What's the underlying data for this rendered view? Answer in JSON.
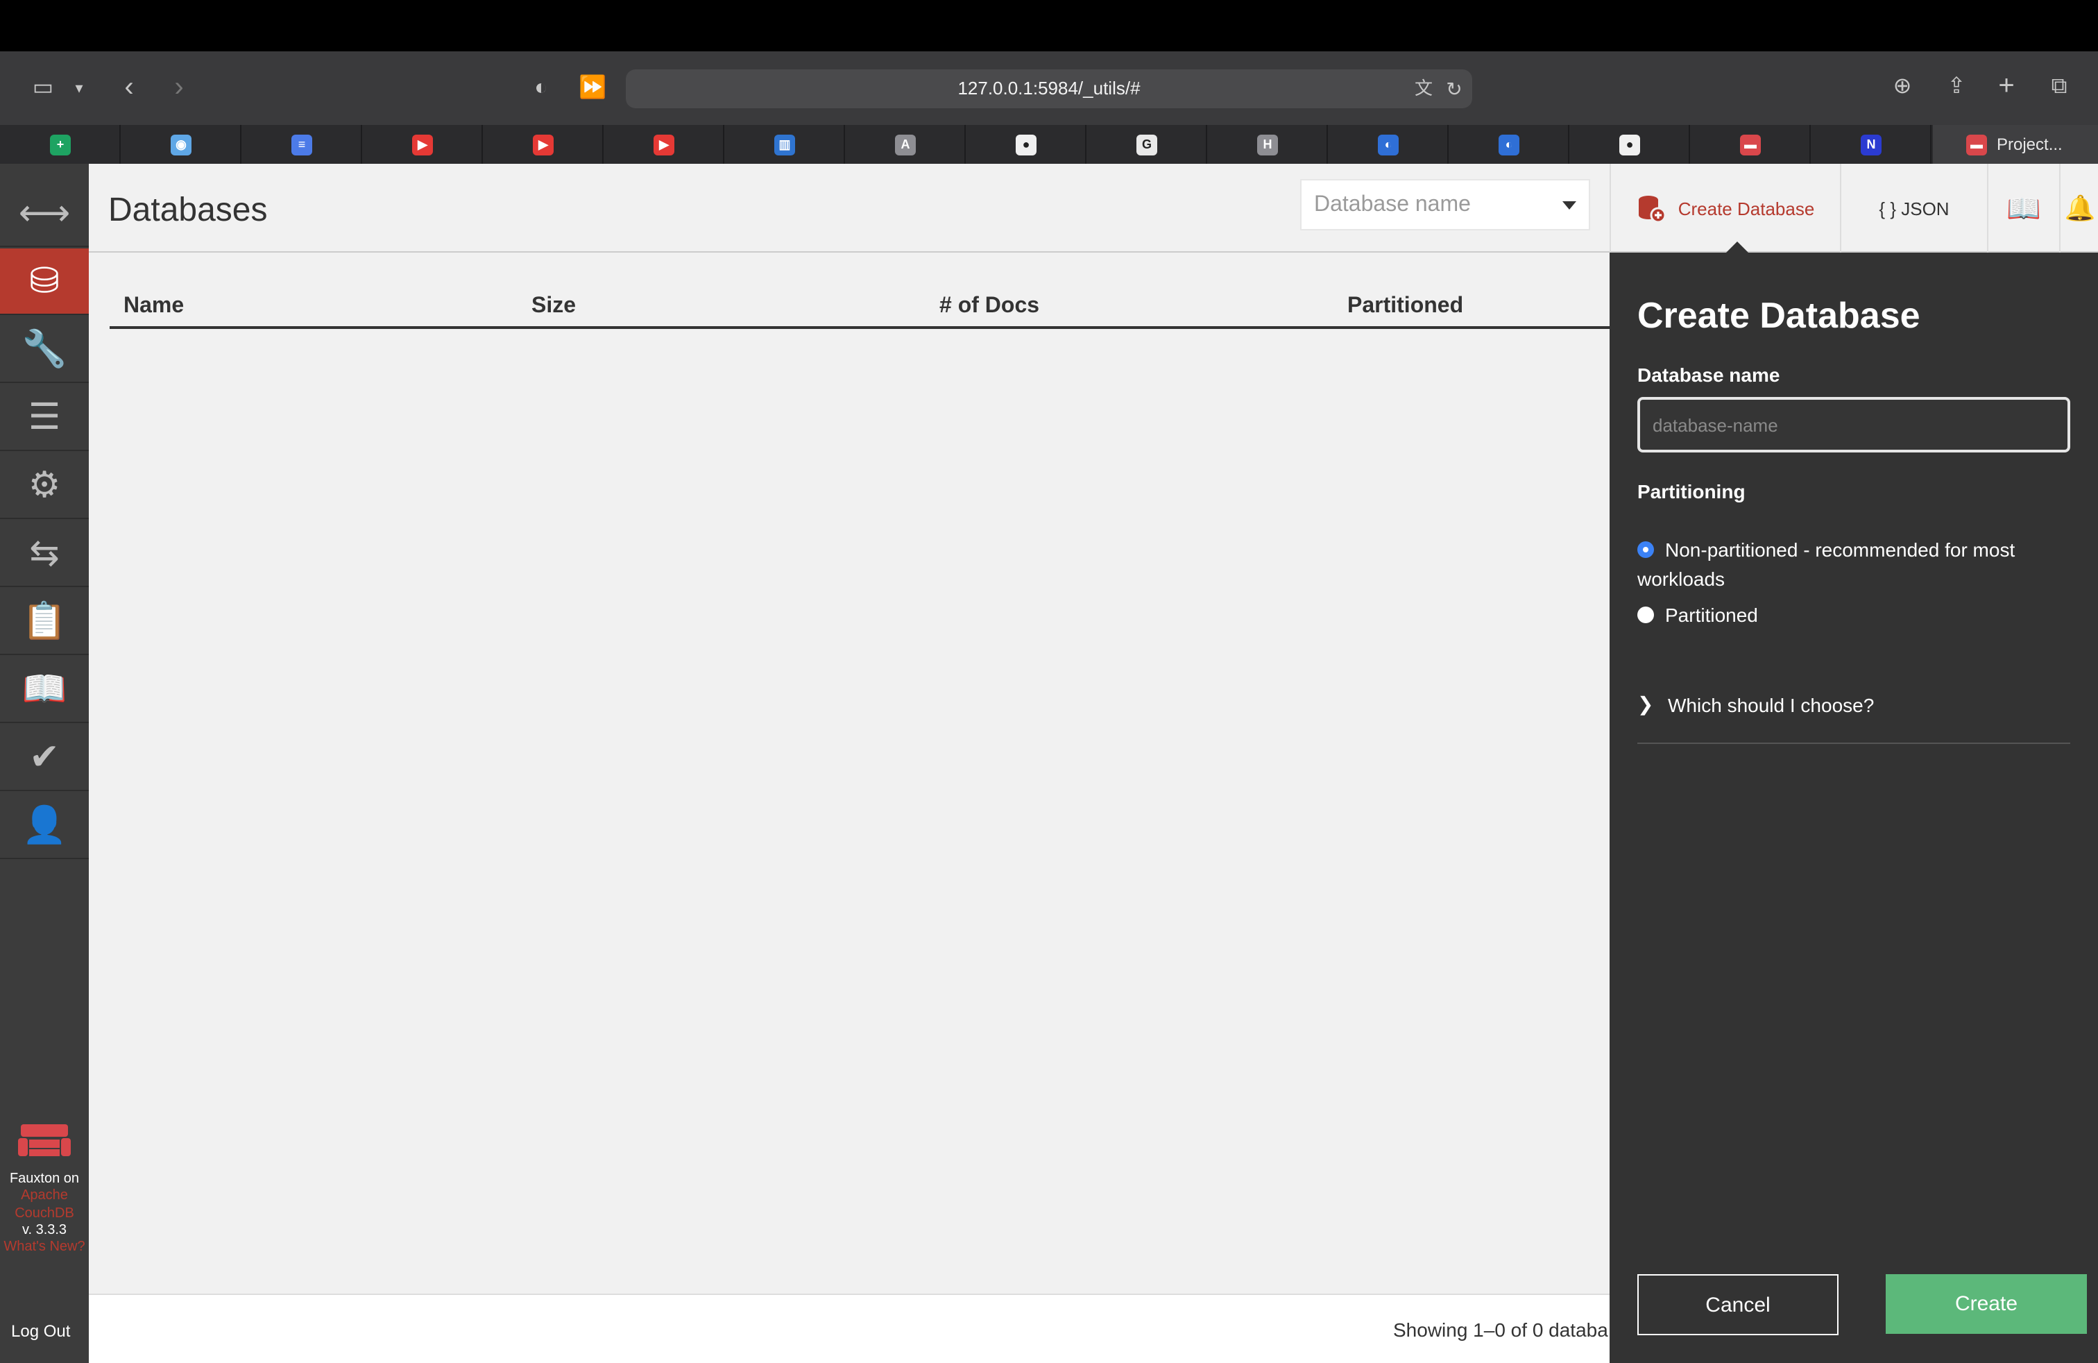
{
  "browser": {
    "url": "127.0.0.1:5984/_utils/#",
    "active_tab_label": "Project...",
    "bookmarks": [
      {
        "icon": "sheets-icon",
        "color": "#1ea362",
        "glyph": "+"
      },
      {
        "icon": "reddit-icon",
        "color": "#5fa7e6",
        "glyph": "◉"
      },
      {
        "icon": "docs-icon",
        "color": "#4c7be8",
        "glyph": "≡"
      },
      {
        "icon": "youtube-icon",
        "color": "#e53935",
        "glyph": "▶"
      },
      {
        "icon": "youtube-icon",
        "color": "#e53935",
        "glyph": "▶"
      },
      {
        "icon": "youtube-icon",
        "color": "#e53935",
        "glyph": "▶"
      },
      {
        "icon": "trello-icon",
        "color": "#2f74d0",
        "glyph": "▥"
      },
      {
        "icon": "a-icon",
        "color": "#8e8e93",
        "glyph": "A"
      },
      {
        "icon": "github-icon",
        "color": "#f0f0f0",
        "glyph": "●"
      },
      {
        "icon": "google-icon",
        "color": "#e9e9e9",
        "glyph": "G"
      },
      {
        "icon": "h-icon",
        "color": "#8e8e93",
        "glyph": "H"
      },
      {
        "icon": "docker-icon",
        "color": "#2f6fd6",
        "glyph": "◐"
      },
      {
        "icon": "docker-icon",
        "color": "#2f6fd6",
        "glyph": "◐"
      },
      {
        "icon": "github-icon",
        "color": "#f0f0f0",
        "glyph": "●"
      },
      {
        "icon": "couchdb-icon",
        "color": "#d9474b",
        "glyph": "▬"
      },
      {
        "icon": "n-icon",
        "color": "#2b3bd1",
        "glyph": "N"
      }
    ]
  },
  "sidebar": {
    "items": [
      {
        "name": "nav-toggle",
        "icon": "expand-arrows-icon",
        "glyph": "⟷"
      },
      {
        "name": "nav-databases",
        "icon": "database-icon",
        "glyph": "⛁"
      },
      {
        "name": "nav-setup",
        "icon": "wrench-icon",
        "glyph": "🔧"
      },
      {
        "name": "nav-active-tasks",
        "icon": "tasks-icon",
        "glyph": "☰"
      },
      {
        "name": "nav-config",
        "icon": "gear-icon",
        "glyph": "⚙"
      },
      {
        "name": "nav-replication",
        "icon": "replication-icon",
        "glyph": "⇆"
      },
      {
        "name": "nav-logs",
        "icon": "clipboard-icon",
        "glyph": "📋"
      },
      {
        "name": "nav-documentation",
        "icon": "book-icon",
        "glyph": "📖"
      },
      {
        "name": "nav-verify",
        "icon": "check-circle-icon",
        "glyph": "✔"
      },
      {
        "name": "nav-user",
        "icon": "user-icon",
        "glyph": "👤"
      }
    ],
    "brand_line1": "Fauxton on",
    "brand_line2": "Apache",
    "brand_line3": "CouchDB",
    "version": "v. 3.3.3",
    "whats_new": "What's New?",
    "logout": "Log Out"
  },
  "header": {
    "title": "Databases",
    "search_placeholder": "Database name",
    "create_label": "Create Database",
    "json_label": "{ } JSON"
  },
  "table": {
    "columns": [
      "Name",
      "Size",
      "# of Docs",
      "Partitioned"
    ]
  },
  "footer": {
    "showing": "Showing 1–0 of 0 databa"
  },
  "tray": {
    "title": "Create Database",
    "name_label": "Database name",
    "name_placeholder": "database-name",
    "partitioning_label": "Partitioning",
    "option_non_partitioned": "Non-partitioned - recommended for most workloads",
    "option_partitioned": "Partitioned",
    "chooser": "Which should I choose?",
    "cancel": "Cancel",
    "create": "Create"
  }
}
